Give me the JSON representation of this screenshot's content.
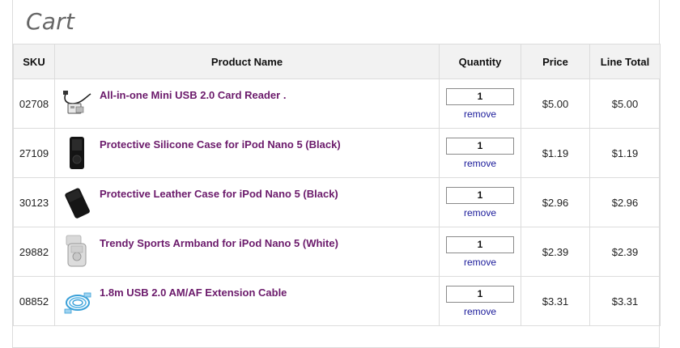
{
  "cart": {
    "title": "Cart",
    "columns": {
      "sku": "SKU",
      "product": "Product Name",
      "quantity": "Quantity",
      "price": "Price",
      "line_total": "Line Total"
    },
    "remove_label": "remove",
    "items": [
      {
        "sku": "02708",
        "name": "All-in-one Mini USB 2.0 Card Reader .",
        "quantity": "1",
        "price": "$5.00",
        "line_total": "$5.00",
        "thumb_icon": "card-reader-icon"
      },
      {
        "sku": "27109",
        "name": "Protective Silicone Case for iPod Nano 5 (Black)",
        "quantity": "1",
        "price": "$1.19",
        "line_total": "$1.19",
        "thumb_icon": "silicone-case-icon"
      },
      {
        "sku": "30123",
        "name": "Protective Leather Case for iPod Nano 5 (Black)",
        "quantity": "1",
        "price": "$2.96",
        "line_total": "$2.96",
        "thumb_icon": "leather-case-icon"
      },
      {
        "sku": "29882",
        "name": "Trendy Sports Armband for iPod Nano 5 (White)",
        "quantity": "1",
        "price": "$2.39",
        "line_total": "$2.39",
        "thumb_icon": "armband-icon"
      },
      {
        "sku": "08852",
        "name": "1.8m USB 2.0 AM/AF Extension Cable",
        "quantity": "1",
        "price": "$3.31",
        "line_total": "$3.31",
        "thumb_icon": "usb-cable-icon"
      }
    ]
  }
}
